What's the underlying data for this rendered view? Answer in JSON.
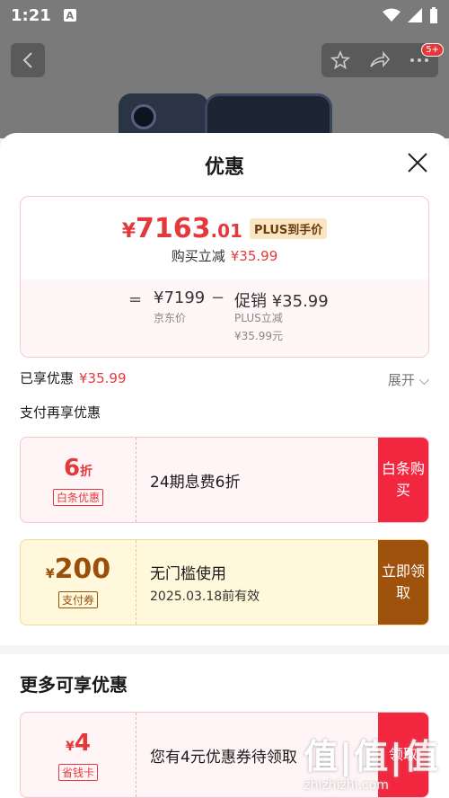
{
  "status_bar": {
    "time": "1:21",
    "app_icon": "A"
  },
  "top_bar": {
    "badge": "5+"
  },
  "sheet": {
    "title": "优惠",
    "price": {
      "yen": "¥",
      "integer": "7163",
      "decimal": ".01",
      "plus_tag": "PLUS到手价",
      "reduce_label": "购买立减",
      "reduce_value": "¥35.99"
    },
    "breakdown": {
      "eq": "=",
      "jd_price": "¥7199",
      "jd_label": "京东价",
      "minus": "−",
      "promo_price": "促销 ¥35.99",
      "promo_sub1": "PLUS立减",
      "promo_sub2": "¥35.99元"
    },
    "enjoyed": {
      "label": "已享优惠",
      "value": "¥35.99",
      "expand": "展开 ⌵"
    },
    "pay_more": "支付再享优惠",
    "coupons": [
      {
        "amount": "6",
        "unit": "折",
        "tag": "白条优惠",
        "desc": "24期息费6折",
        "sub": "",
        "btn": "白条购买"
      },
      {
        "amount": "200",
        "unit": "¥",
        "tag": "支付券",
        "desc": "无门槛使用",
        "sub": "2025.03.18前有效",
        "btn": "立即领取"
      }
    ],
    "more_title": "更多可享优惠",
    "more_coupon": {
      "amount": "4",
      "unit": "¥",
      "tag": "省钱卡",
      "desc": "您有4元优惠券待领取",
      "btn": "领取"
    }
  },
  "watermark": {
    "big": "值|值|值",
    "small": "zhizhizhi.com"
  },
  "colors": {
    "accent_red": "#e4393c",
    "brown": "#9e520b"
  }
}
